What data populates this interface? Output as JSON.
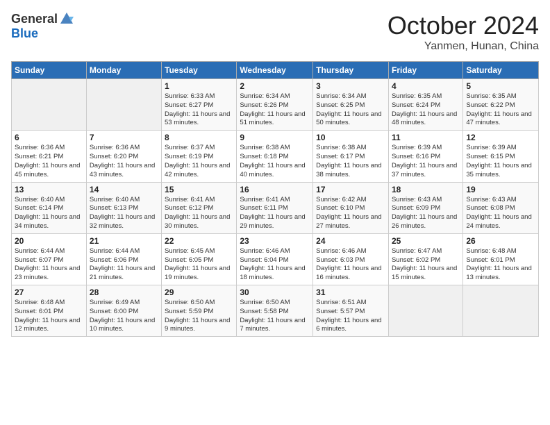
{
  "header": {
    "logo_general": "General",
    "logo_blue": "Blue",
    "month": "October 2024",
    "location": "Yanmen, Hunan, China"
  },
  "weekdays": [
    "Sunday",
    "Monday",
    "Tuesday",
    "Wednesday",
    "Thursday",
    "Friday",
    "Saturday"
  ],
  "weeks": [
    [
      {
        "day": "",
        "info": ""
      },
      {
        "day": "",
        "info": ""
      },
      {
        "day": "1",
        "info": "Sunrise: 6:33 AM\nSunset: 6:27 PM\nDaylight: 11 hours and 53 minutes."
      },
      {
        "day": "2",
        "info": "Sunrise: 6:34 AM\nSunset: 6:26 PM\nDaylight: 11 hours and 51 minutes."
      },
      {
        "day": "3",
        "info": "Sunrise: 6:34 AM\nSunset: 6:25 PM\nDaylight: 11 hours and 50 minutes."
      },
      {
        "day": "4",
        "info": "Sunrise: 6:35 AM\nSunset: 6:24 PM\nDaylight: 11 hours and 48 minutes."
      },
      {
        "day": "5",
        "info": "Sunrise: 6:35 AM\nSunset: 6:22 PM\nDaylight: 11 hours and 47 minutes."
      }
    ],
    [
      {
        "day": "6",
        "info": "Sunrise: 6:36 AM\nSunset: 6:21 PM\nDaylight: 11 hours and 45 minutes."
      },
      {
        "day": "7",
        "info": "Sunrise: 6:36 AM\nSunset: 6:20 PM\nDaylight: 11 hours and 43 minutes."
      },
      {
        "day": "8",
        "info": "Sunrise: 6:37 AM\nSunset: 6:19 PM\nDaylight: 11 hours and 42 minutes."
      },
      {
        "day": "9",
        "info": "Sunrise: 6:38 AM\nSunset: 6:18 PM\nDaylight: 11 hours and 40 minutes."
      },
      {
        "day": "10",
        "info": "Sunrise: 6:38 AM\nSunset: 6:17 PM\nDaylight: 11 hours and 38 minutes."
      },
      {
        "day": "11",
        "info": "Sunrise: 6:39 AM\nSunset: 6:16 PM\nDaylight: 11 hours and 37 minutes."
      },
      {
        "day": "12",
        "info": "Sunrise: 6:39 AM\nSunset: 6:15 PM\nDaylight: 11 hours and 35 minutes."
      }
    ],
    [
      {
        "day": "13",
        "info": "Sunrise: 6:40 AM\nSunset: 6:14 PM\nDaylight: 11 hours and 34 minutes."
      },
      {
        "day": "14",
        "info": "Sunrise: 6:40 AM\nSunset: 6:13 PM\nDaylight: 11 hours and 32 minutes."
      },
      {
        "day": "15",
        "info": "Sunrise: 6:41 AM\nSunset: 6:12 PM\nDaylight: 11 hours and 30 minutes."
      },
      {
        "day": "16",
        "info": "Sunrise: 6:41 AM\nSunset: 6:11 PM\nDaylight: 11 hours and 29 minutes."
      },
      {
        "day": "17",
        "info": "Sunrise: 6:42 AM\nSunset: 6:10 PM\nDaylight: 11 hours and 27 minutes."
      },
      {
        "day": "18",
        "info": "Sunrise: 6:43 AM\nSunset: 6:09 PM\nDaylight: 11 hours and 26 minutes."
      },
      {
        "day": "19",
        "info": "Sunrise: 6:43 AM\nSunset: 6:08 PM\nDaylight: 11 hours and 24 minutes."
      }
    ],
    [
      {
        "day": "20",
        "info": "Sunrise: 6:44 AM\nSunset: 6:07 PM\nDaylight: 11 hours and 23 minutes."
      },
      {
        "day": "21",
        "info": "Sunrise: 6:44 AM\nSunset: 6:06 PM\nDaylight: 11 hours and 21 minutes."
      },
      {
        "day": "22",
        "info": "Sunrise: 6:45 AM\nSunset: 6:05 PM\nDaylight: 11 hours and 19 minutes."
      },
      {
        "day": "23",
        "info": "Sunrise: 6:46 AM\nSunset: 6:04 PM\nDaylight: 11 hours and 18 minutes."
      },
      {
        "day": "24",
        "info": "Sunrise: 6:46 AM\nSunset: 6:03 PM\nDaylight: 11 hours and 16 minutes."
      },
      {
        "day": "25",
        "info": "Sunrise: 6:47 AM\nSunset: 6:02 PM\nDaylight: 11 hours and 15 minutes."
      },
      {
        "day": "26",
        "info": "Sunrise: 6:48 AM\nSunset: 6:01 PM\nDaylight: 11 hours and 13 minutes."
      }
    ],
    [
      {
        "day": "27",
        "info": "Sunrise: 6:48 AM\nSunset: 6:01 PM\nDaylight: 11 hours and 12 minutes."
      },
      {
        "day": "28",
        "info": "Sunrise: 6:49 AM\nSunset: 6:00 PM\nDaylight: 11 hours and 10 minutes."
      },
      {
        "day": "29",
        "info": "Sunrise: 6:50 AM\nSunset: 5:59 PM\nDaylight: 11 hours and 9 minutes."
      },
      {
        "day": "30",
        "info": "Sunrise: 6:50 AM\nSunset: 5:58 PM\nDaylight: 11 hours and 7 minutes."
      },
      {
        "day": "31",
        "info": "Sunrise: 6:51 AM\nSunset: 5:57 PM\nDaylight: 11 hours and 6 minutes."
      },
      {
        "day": "",
        "info": ""
      },
      {
        "day": "",
        "info": ""
      }
    ]
  ]
}
